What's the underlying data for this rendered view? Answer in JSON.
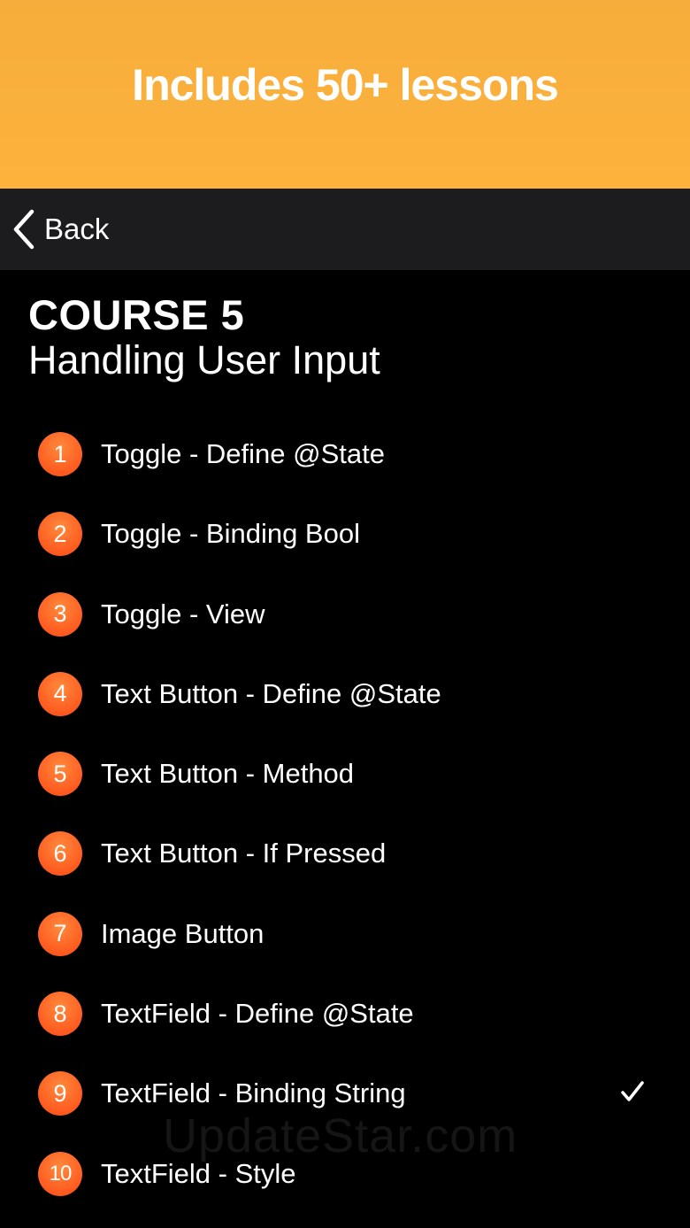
{
  "banner": {
    "title": "Includes 50+ lessons"
  },
  "nav": {
    "back_label": "Back"
  },
  "course": {
    "number": "COURSE 5",
    "title": "Handling User Input"
  },
  "lessons": [
    {
      "num": "1",
      "label": "Toggle - Define @State",
      "completed": false
    },
    {
      "num": "2",
      "label": "Toggle - Binding Bool",
      "completed": false
    },
    {
      "num": "3",
      "label": "Toggle - View",
      "completed": false
    },
    {
      "num": "4",
      "label": "Text Button - Define @State",
      "completed": false
    },
    {
      "num": "5",
      "label": "Text Button - Method",
      "completed": false
    },
    {
      "num": "6",
      "label": "Text Button - If Pressed",
      "completed": false
    },
    {
      "num": "7",
      "label": "Image Button",
      "completed": false
    },
    {
      "num": "8",
      "label": "TextField - Define @State",
      "completed": false
    },
    {
      "num": "9",
      "label": "TextField - Binding String",
      "completed": true
    },
    {
      "num": "10",
      "label": "TextField - Style",
      "completed": false
    }
  ],
  "watermark": "UpdateStar.com",
  "colors": {
    "banner": "#fdb23c",
    "navbar": "#1c1c1e",
    "badge": "#ff5a1f",
    "background": "#000000"
  }
}
